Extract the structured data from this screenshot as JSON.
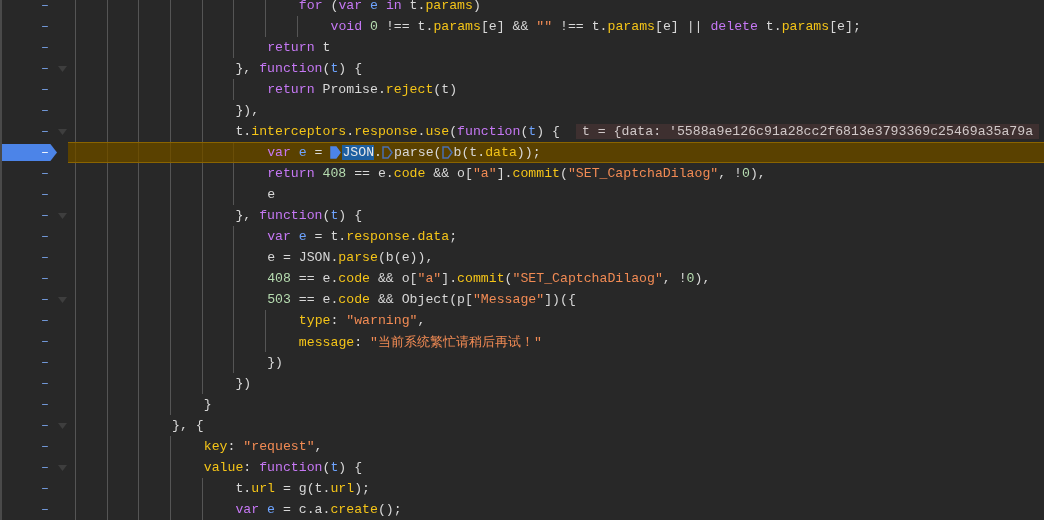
{
  "editor": {
    "lines": [
      {
        "number": "–",
        "breakpoint": false,
        "paused": false,
        "foldable": false,
        "guides": [
          {
            "kind": "guide"
          },
          {
            "kind": "guide"
          },
          {
            "kind": "guide"
          },
          {
            "kind": "guide"
          },
          {
            "kind": "guide"
          },
          {
            "kind": "guide"
          },
          {
            "kind": "guide"
          }
        ],
        "tokens": [
          {
            "kind": "kw",
            "text": "for "
          },
          {
            "kind": "p",
            "text": "("
          },
          {
            "kind": "kw",
            "text": "var "
          },
          {
            "kind": "v",
            "text": "e "
          },
          {
            "kind": "kw",
            "text": "in"
          },
          {
            "kind": "p",
            "text": " t."
          },
          {
            "kind": "pr",
            "text": "params"
          },
          {
            "kind": "p",
            "text": ")"
          }
        ]
      },
      {
        "number": "–",
        "breakpoint": false,
        "paused": false,
        "foldable": false,
        "guides": [
          {
            "kind": "guide"
          },
          {
            "kind": "guide"
          },
          {
            "kind": "guide"
          },
          {
            "kind": "guide"
          },
          {
            "kind": "guide"
          },
          {
            "kind": "guide"
          },
          {
            "kind": "guide"
          },
          {
            "kind": "guide"
          }
        ],
        "tokens": [
          {
            "kind": "kw",
            "text": "void "
          },
          {
            "kind": "n",
            "text": "0"
          },
          {
            "kind": "p",
            "text": " !== t."
          },
          {
            "kind": "pr",
            "text": "params"
          },
          {
            "kind": "p",
            "text": "[e] && "
          },
          {
            "kind": "s",
            "text": "\"\""
          },
          {
            "kind": "p",
            "text": " !== t."
          },
          {
            "kind": "pr",
            "text": "params"
          },
          {
            "kind": "p",
            "text": "[e] || "
          },
          {
            "kind": "kw",
            "text": "delete"
          },
          {
            "kind": "p",
            "text": " t."
          },
          {
            "kind": "pr",
            "text": "params"
          },
          {
            "kind": "p",
            "text": "[e];"
          }
        ]
      },
      {
        "number": "–",
        "breakpoint": false,
        "paused": false,
        "foldable": false,
        "guides": [
          {
            "kind": "guide"
          },
          {
            "kind": "guide"
          },
          {
            "kind": "guide"
          },
          {
            "kind": "guide"
          },
          {
            "kind": "guide"
          },
          {
            "kind": "guide"
          }
        ],
        "tokens": [
          {
            "kind": "kw",
            "text": "return"
          },
          {
            "kind": "p",
            "text": " t"
          }
        ]
      },
      {
        "number": "–",
        "breakpoint": false,
        "paused": false,
        "foldable": true,
        "expanded": true,
        "guides": [
          {
            "kind": "guide"
          },
          {
            "kind": "guide"
          },
          {
            "kind": "guide"
          },
          {
            "kind": "guide"
          },
          {
            "kind": "guide"
          }
        ],
        "tokens": [
          {
            "kind": "p",
            "text": "}, "
          },
          {
            "kind": "kw",
            "text": "function"
          },
          {
            "kind": "p",
            "text": "("
          },
          {
            "kind": "v",
            "text": "t"
          },
          {
            "kind": "p",
            "text": ") {"
          }
        ]
      },
      {
        "number": "–",
        "breakpoint": false,
        "paused": false,
        "foldable": false,
        "guides": [
          {
            "kind": "guide"
          },
          {
            "kind": "guide"
          },
          {
            "kind": "guide"
          },
          {
            "kind": "guide"
          },
          {
            "kind": "guide"
          },
          {
            "kind": "guide"
          }
        ],
        "tokens": [
          {
            "kind": "kw",
            "text": "return"
          },
          {
            "kind": "p",
            "text": " Promise."
          },
          {
            "kind": "pr",
            "text": "reject"
          },
          {
            "kind": "p",
            "text": "(t)"
          }
        ]
      },
      {
        "number": "–",
        "breakpoint": false,
        "paused": false,
        "foldable": false,
        "guides": [
          {
            "kind": "guide"
          },
          {
            "kind": "guide"
          },
          {
            "kind": "guide"
          },
          {
            "kind": "guide"
          },
          {
            "kind": "guide"
          }
        ],
        "tokens": [
          {
            "kind": "p",
            "text": "}),"
          }
        ]
      },
      {
        "number": "–",
        "breakpoint": false,
        "paused": false,
        "foldable": true,
        "expanded": true,
        "guides": [
          {
            "kind": "guide"
          },
          {
            "kind": "guide"
          },
          {
            "kind": "guide"
          },
          {
            "kind": "guide"
          },
          {
            "kind": "guide"
          }
        ],
        "tokens": [
          {
            "kind": "p",
            "text": "t."
          },
          {
            "kind": "pr",
            "text": "interceptors"
          },
          {
            "kind": "p",
            "text": "."
          },
          {
            "kind": "pr",
            "text": "response"
          },
          {
            "kind": "p",
            "text": "."
          },
          {
            "kind": "pr",
            "text": "use"
          },
          {
            "kind": "p",
            "text": "("
          },
          {
            "kind": "kw",
            "text": "function"
          },
          {
            "kind": "p",
            "text": "("
          },
          {
            "kind": "v",
            "text": "t"
          },
          {
            "kind": "p",
            "text": ") {"
          }
        ],
        "inline_value": "t = {data: '5588a9e126c91a28cc2f6813e3793369c25469a35a79a"
      },
      {
        "number": "–",
        "breakpoint": true,
        "paused": true,
        "foldable": false,
        "guides": [
          {
            "kind": "guide"
          },
          {
            "kind": "guide"
          },
          {
            "kind": "guide"
          },
          {
            "kind": "guide"
          },
          {
            "kind": "guide"
          },
          {
            "kind": "guide"
          }
        ],
        "tokens": [
          {
            "kind": "kw",
            "text": "var "
          },
          {
            "kind": "v",
            "text": "e"
          },
          {
            "kind": "p",
            "text": " = "
          },
          {
            "kind": "marker",
            "active": true
          },
          {
            "kind": "sel",
            "text": "JSON"
          },
          {
            "kind": "p",
            "text": "."
          },
          {
            "kind": "marker",
            "active": false
          },
          {
            "kind": "p",
            "text": "parse("
          },
          {
            "kind": "marker",
            "active": false
          },
          {
            "kind": "p",
            "text": "b(t."
          },
          {
            "kind": "pr",
            "text": "data"
          },
          {
            "kind": "p",
            "text": "));"
          }
        ]
      },
      {
        "number": "–",
        "breakpoint": false,
        "paused": false,
        "foldable": false,
        "guides": [
          {
            "kind": "guide"
          },
          {
            "kind": "guide"
          },
          {
            "kind": "guide"
          },
          {
            "kind": "guide"
          },
          {
            "kind": "guide"
          },
          {
            "kind": "guide"
          }
        ],
        "tokens": [
          {
            "kind": "kw",
            "text": "return "
          },
          {
            "kind": "n",
            "text": "408"
          },
          {
            "kind": "p",
            "text": " == e."
          },
          {
            "kind": "pr",
            "text": "code"
          },
          {
            "kind": "p",
            "text": " && o["
          },
          {
            "kind": "s",
            "text": "\"a\""
          },
          {
            "kind": "p",
            "text": "]."
          },
          {
            "kind": "pr",
            "text": "commit"
          },
          {
            "kind": "p",
            "text": "("
          },
          {
            "kind": "s",
            "text": "\"SET_CaptchaDilaog\""
          },
          {
            "kind": "p",
            "text": ", !"
          },
          {
            "kind": "n",
            "text": "0"
          },
          {
            "kind": "p",
            "text": "),"
          }
        ]
      },
      {
        "number": "–",
        "breakpoint": false,
        "paused": false,
        "foldable": false,
        "guides": [
          {
            "kind": "guide"
          },
          {
            "kind": "guide"
          },
          {
            "kind": "guide"
          },
          {
            "kind": "guide"
          },
          {
            "kind": "guide"
          },
          {
            "kind": "guide"
          }
        ],
        "tokens": [
          {
            "kind": "p",
            "text": "e"
          }
        ]
      },
      {
        "number": "–",
        "breakpoint": false,
        "paused": false,
        "foldable": true,
        "expanded": true,
        "guides": [
          {
            "kind": "guide"
          },
          {
            "kind": "guide"
          },
          {
            "kind": "guide"
          },
          {
            "kind": "guide"
          },
          {
            "kind": "guide"
          }
        ],
        "tokens": [
          {
            "kind": "p",
            "text": "}, "
          },
          {
            "kind": "kw",
            "text": "function"
          },
          {
            "kind": "p",
            "text": "("
          },
          {
            "kind": "v",
            "text": "t"
          },
          {
            "kind": "p",
            "text": ") {"
          }
        ]
      },
      {
        "number": "–",
        "breakpoint": false,
        "paused": false,
        "foldable": false,
        "guides": [
          {
            "kind": "guide"
          },
          {
            "kind": "guide"
          },
          {
            "kind": "guide"
          },
          {
            "kind": "guide"
          },
          {
            "kind": "guide"
          },
          {
            "kind": "guide"
          }
        ],
        "tokens": [
          {
            "kind": "kw",
            "text": "var "
          },
          {
            "kind": "v",
            "text": "e"
          },
          {
            "kind": "p",
            "text": " = t."
          },
          {
            "kind": "pr",
            "text": "response"
          },
          {
            "kind": "p",
            "text": "."
          },
          {
            "kind": "pr",
            "text": "data"
          },
          {
            "kind": "p",
            "text": ";"
          }
        ]
      },
      {
        "number": "–",
        "breakpoint": false,
        "paused": false,
        "foldable": false,
        "guides": [
          {
            "kind": "guide"
          },
          {
            "kind": "guide"
          },
          {
            "kind": "guide"
          },
          {
            "kind": "guide"
          },
          {
            "kind": "guide"
          },
          {
            "kind": "guide"
          }
        ],
        "tokens": [
          {
            "kind": "p",
            "text": "e = JSON."
          },
          {
            "kind": "pr",
            "text": "parse"
          },
          {
            "kind": "p",
            "text": "(b(e)),"
          }
        ]
      },
      {
        "number": "–",
        "breakpoint": false,
        "paused": false,
        "foldable": false,
        "guides": [
          {
            "kind": "guide"
          },
          {
            "kind": "guide"
          },
          {
            "kind": "guide"
          },
          {
            "kind": "guide"
          },
          {
            "kind": "guide"
          },
          {
            "kind": "guide"
          }
        ],
        "tokens": [
          {
            "kind": "n",
            "text": "408"
          },
          {
            "kind": "p",
            "text": " == e."
          },
          {
            "kind": "pr",
            "text": "code"
          },
          {
            "kind": "p",
            "text": " && o["
          },
          {
            "kind": "s",
            "text": "\"a\""
          },
          {
            "kind": "p",
            "text": "]."
          },
          {
            "kind": "pr",
            "text": "commit"
          },
          {
            "kind": "p",
            "text": "("
          },
          {
            "kind": "s",
            "text": "\"SET_CaptchaDilaog\""
          },
          {
            "kind": "p",
            "text": ", !"
          },
          {
            "kind": "n",
            "text": "0"
          },
          {
            "kind": "p",
            "text": "),"
          }
        ]
      },
      {
        "number": "–",
        "breakpoint": false,
        "paused": false,
        "foldable": true,
        "expanded": true,
        "guides": [
          {
            "kind": "guide"
          },
          {
            "kind": "guide"
          },
          {
            "kind": "guide"
          },
          {
            "kind": "guide"
          },
          {
            "kind": "guide"
          },
          {
            "kind": "guide"
          }
        ],
        "tokens": [
          {
            "kind": "n",
            "text": "503"
          },
          {
            "kind": "p",
            "text": " == e."
          },
          {
            "kind": "pr",
            "text": "code"
          },
          {
            "kind": "p",
            "text": " && Object(p["
          },
          {
            "kind": "s",
            "text": "\"Message\""
          },
          {
            "kind": "p",
            "text": "])({"
          }
        ]
      },
      {
        "number": "–",
        "breakpoint": false,
        "paused": false,
        "foldable": false,
        "guides": [
          {
            "kind": "guide"
          },
          {
            "kind": "guide"
          },
          {
            "kind": "guide"
          },
          {
            "kind": "guide"
          },
          {
            "kind": "guide"
          },
          {
            "kind": "guide"
          },
          {
            "kind": "guide"
          }
        ],
        "tokens": [
          {
            "kind": "pr",
            "text": "type"
          },
          {
            "kind": "p",
            "text": ": "
          },
          {
            "kind": "s",
            "text": "\"warning\""
          },
          {
            "kind": "p",
            "text": ","
          }
        ]
      },
      {
        "number": "–",
        "breakpoint": false,
        "paused": false,
        "foldable": false,
        "guides": [
          {
            "kind": "guide"
          },
          {
            "kind": "guide"
          },
          {
            "kind": "guide"
          },
          {
            "kind": "guide"
          },
          {
            "kind": "guide"
          },
          {
            "kind": "guide"
          },
          {
            "kind": "guide"
          }
        ],
        "tokens": [
          {
            "kind": "pr",
            "text": "message"
          },
          {
            "kind": "p",
            "text": ": "
          },
          {
            "kind": "s",
            "text": "\"当前系统繁忙请稍后再试！\""
          }
        ]
      },
      {
        "number": "–",
        "breakpoint": false,
        "paused": false,
        "foldable": false,
        "guides": [
          {
            "kind": "guide"
          },
          {
            "kind": "guide"
          },
          {
            "kind": "guide"
          },
          {
            "kind": "guide"
          },
          {
            "kind": "guide"
          },
          {
            "kind": "guide"
          }
        ],
        "tokens": [
          {
            "kind": "p",
            "text": "})"
          }
        ]
      },
      {
        "number": "–",
        "breakpoint": false,
        "paused": false,
        "foldable": false,
        "guides": [
          {
            "kind": "guide"
          },
          {
            "kind": "guide"
          },
          {
            "kind": "guide"
          },
          {
            "kind": "guide"
          },
          {
            "kind": "guide"
          }
        ],
        "tokens": [
          {
            "kind": "p",
            "text": "})"
          }
        ]
      },
      {
        "number": "–",
        "breakpoint": false,
        "paused": false,
        "foldable": false,
        "guides": [
          {
            "kind": "guide"
          },
          {
            "kind": "guide"
          },
          {
            "kind": "guide"
          },
          {
            "kind": "guide"
          }
        ],
        "tokens": [
          {
            "kind": "p",
            "text": "}"
          }
        ]
      },
      {
        "number": "–",
        "breakpoint": false,
        "paused": false,
        "foldable": true,
        "expanded": true,
        "guides": [
          {
            "kind": "guide"
          },
          {
            "kind": "guide"
          },
          {
            "kind": "guide"
          }
        ],
        "tokens": [
          {
            "kind": "p",
            "text": "}, {"
          }
        ]
      },
      {
        "number": "–",
        "breakpoint": false,
        "paused": false,
        "foldable": false,
        "guides": [
          {
            "kind": "guide"
          },
          {
            "kind": "guide"
          },
          {
            "kind": "guide"
          },
          {
            "kind": "guide"
          }
        ],
        "tokens": [
          {
            "kind": "pr",
            "text": "key"
          },
          {
            "kind": "p",
            "text": ": "
          },
          {
            "kind": "s",
            "text": "\"request\""
          },
          {
            "kind": "p",
            "text": ","
          }
        ]
      },
      {
        "number": "–",
        "breakpoint": false,
        "paused": false,
        "foldable": true,
        "expanded": true,
        "guides": [
          {
            "kind": "guide"
          },
          {
            "kind": "guide"
          },
          {
            "kind": "guide"
          },
          {
            "kind": "guide"
          }
        ],
        "tokens": [
          {
            "kind": "pr",
            "text": "value"
          },
          {
            "kind": "p",
            "text": ": "
          },
          {
            "kind": "kw",
            "text": "function"
          },
          {
            "kind": "p",
            "text": "("
          },
          {
            "kind": "v",
            "text": "t"
          },
          {
            "kind": "p",
            "text": ") {"
          }
        ]
      },
      {
        "number": "–",
        "breakpoint": false,
        "paused": false,
        "foldable": false,
        "guides": [
          {
            "kind": "guide"
          },
          {
            "kind": "guide"
          },
          {
            "kind": "guide"
          },
          {
            "kind": "guide"
          },
          {
            "kind": "guide"
          }
        ],
        "tokens": [
          {
            "kind": "p",
            "text": "t."
          },
          {
            "kind": "pr",
            "text": "url"
          },
          {
            "kind": "p",
            "text": " = g(t."
          },
          {
            "kind": "pr",
            "text": "url"
          },
          {
            "kind": "p",
            "text": ");"
          }
        ]
      },
      {
        "number": "–",
        "breakpoint": false,
        "paused": false,
        "foldable": false,
        "guides": [
          {
            "kind": "guide"
          },
          {
            "kind": "guide"
          },
          {
            "kind": "guide"
          },
          {
            "kind": "guide"
          },
          {
            "kind": "guide"
          }
        ],
        "tokens": [
          {
            "kind": "kw",
            "text": "var "
          },
          {
            "kind": "v",
            "text": "e"
          },
          {
            "kind": "p",
            "text": " = c.a."
          },
          {
            "kind": "pr",
            "text": "create"
          },
          {
            "kind": "p",
            "text": "();"
          }
        ]
      }
    ]
  }
}
